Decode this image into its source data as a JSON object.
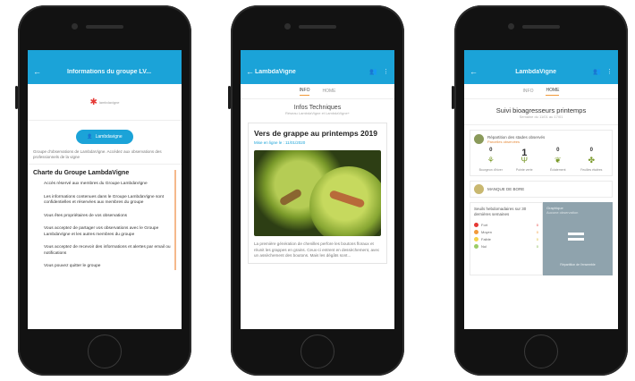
{
  "screen1": {
    "appbar_title": "Informations du groupe LV...",
    "back_icon": "arrow-left-icon",
    "logo_text": "lambdavigne",
    "join_button_label": "Lambdavigne",
    "intro_text": "Groupe d'observations de LambdaVigne. Accédez aux observations des professionnels de la vigne",
    "charte_title": "Charte du Groupe LambdaVigne",
    "charte_items": [
      "Accès réservé aux membres du Groupe LambdaVigne",
      "Les informations contenues dans le Groupe LambdaVigne sont confidentielles et réservées aux membres du groupe",
      "Vous êtes propriétaires de vos observations",
      "Vous acceptez de partager vos observations avec le Groupe LambdaVigne et les autres membres du groupe",
      "Vous acceptez de recevoir des informations et alertes par email ou notifications",
      "Vous pouvez quitter le groupe"
    ]
  },
  "screen2": {
    "appbar_title": "LambdaVigne",
    "tabs": [
      "INFO",
      "HOME"
    ],
    "section_title": "Infos Techniques",
    "section_subtitle": "Réseau LambdaVigne et LambdaVigne+",
    "card_title": "Vers de grappe au printemps 2019",
    "card_link": "Mise en ligne le : 11/01/2020",
    "card_text": "La première génération de chenilles perfore les boutons floraux et réunit les grappes en grains. Ceux-ci entrent en dessèchement, avec un assèchement des boutons. Mais les dégâts sont..."
  },
  "screen3": {
    "appbar_title": "LambdaVigne",
    "tabs": [
      "INFO",
      "HOME"
    ],
    "suivi_title": "Suivi bioagresseurs printemps",
    "suivi_subtitle": "Semaine du 11/01 au 17/01",
    "sec1_title": "Répartition des stades observés",
    "sec1_subtitle": "Parcelles observées",
    "stages": [
      {
        "count": "0",
        "label": "Bourgeon d'hiver",
        "icon": "bud-icon"
      },
      {
        "count": "1",
        "label": "Pointe verte",
        "icon": "sprout-icon"
      },
      {
        "count": "0",
        "label": "Éclatement",
        "icon": "leaf-icon"
      },
      {
        "count": "0",
        "label": "Feuilles étalées",
        "icon": "leaves-icon"
      }
    ],
    "sec2_title": "MANQUE DE BORE",
    "table_header": "Seuils hebdomadaires sur 30 dernières semaines",
    "rows": [
      {
        "label": "Fort",
        "value": "0",
        "color": "#e53935"
      },
      {
        "label": "Moyen",
        "value": "0",
        "color": "#f29a3a"
      },
      {
        "label": "Faible",
        "value": "0",
        "color": "#f5d34a"
      },
      {
        "label": "Nul",
        "value": "0",
        "color": "#9ccc65"
      }
    ],
    "side_title": "Graphique",
    "side_subtitle": "Aucune observation",
    "side_footer": "Répartition de l'ensemble"
  }
}
